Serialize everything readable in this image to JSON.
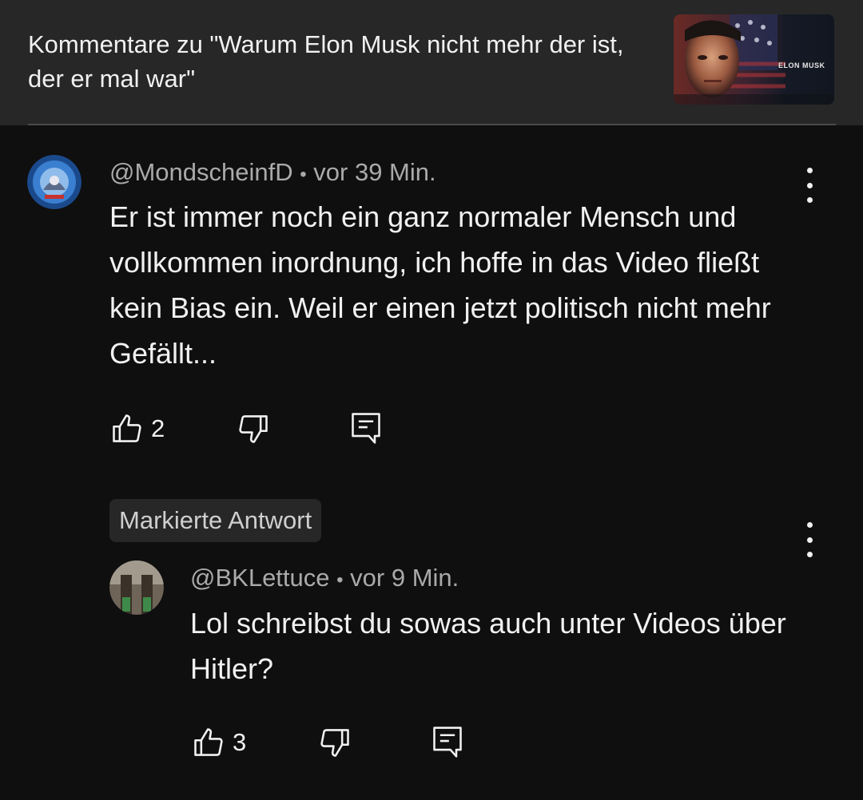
{
  "header": {
    "title": "Kommentare zu \"Warum Elon Musk nicht mehr der ist, der er mal war\"",
    "thumbnail": {
      "label": "ELON MUSK"
    }
  },
  "comment": {
    "author": "@MondscheinfD",
    "separator": "•",
    "time": "vor 39 Min.",
    "text": "Er ist immer noch ein ganz normaler Mensch und vollkommen inordnung, ich hoffe in das Video fließt kein Bias ein. Weil er einen jetzt politisch nicht mehr Gefällt...",
    "likes": "2"
  },
  "reply": {
    "badge": "Markierte Antwort",
    "author": "@BKLettuce",
    "separator": "•",
    "time": "vor 9 Min.",
    "text": "Lol schreibst du sowas auch unter Videos über Hitler?",
    "likes": "3"
  },
  "icons": {
    "like": "thumbs-up-icon",
    "dislike": "thumbs-down-icon",
    "reply": "reply-icon",
    "more": "more-vertical-icon"
  },
  "colors": {
    "background": "#0f0f0f",
    "header": "#272727",
    "text": "#f1f1f1",
    "meta": "#aaaaaa"
  }
}
